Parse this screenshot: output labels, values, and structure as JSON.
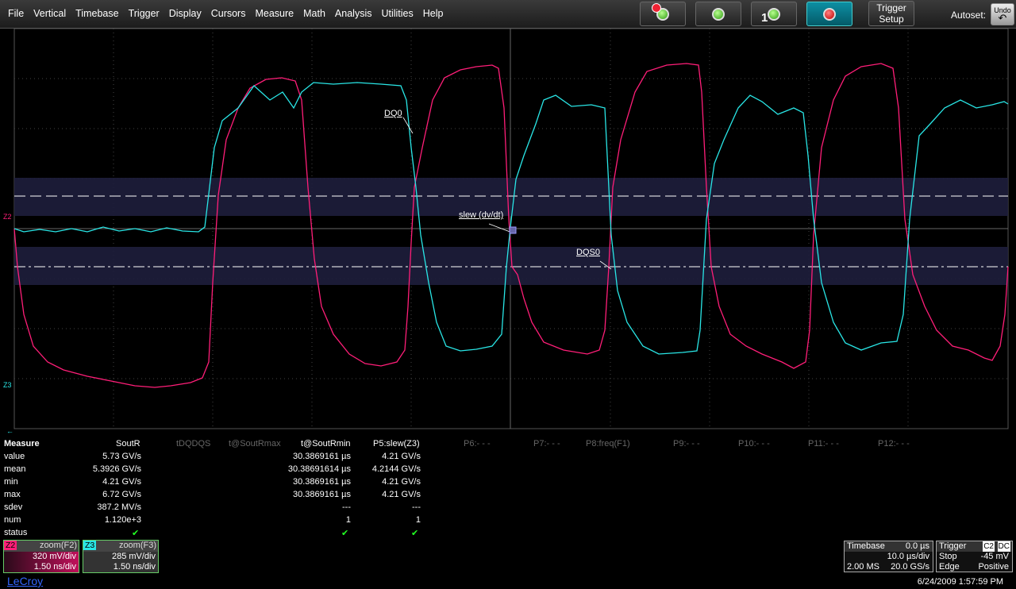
{
  "menu": [
    "File",
    "Vertical",
    "Timebase",
    "Trigger",
    "Display",
    "Cursors",
    "Measure",
    "Math",
    "Analysis",
    "Utilities",
    "Help"
  ],
  "toolbar": {
    "channel_number": "1",
    "trigger_setup_line1": "Trigger",
    "trigger_setup_line2": "Setup",
    "autoset": "Autoset:",
    "undo": "Undo"
  },
  "waveform": {
    "annotation_dq0": "DQ0",
    "annotation_slew": "slew (dv/dt)",
    "annotation_dqs0": "DQS0",
    "marker_z2": "Z2",
    "marker_z3": "Z3"
  },
  "measure": {
    "header": [
      "Measure",
      "SoutR",
      "tDQDQS",
      "t@SoutRmax",
      "t@SoutRmin",
      "P5:slew(Z3)",
      "P6:- - -",
      "P7:- - -",
      "P8:freq(F1)",
      "P9:- - -",
      "P10:- - -",
      "P11:- - -",
      "P12:- - -"
    ],
    "rows": [
      {
        "label": "value",
        "soutr": "5.73 GV/s",
        "tsoutrmin": "30.3869161 µs",
        "p5": "4.21 GV/s"
      },
      {
        "label": "mean",
        "soutr": "5.3926 GV/s",
        "tsoutrmin": "30.38691614 µs",
        "p5": "4.2144 GV/s"
      },
      {
        "label": "min",
        "soutr": "4.21 GV/s",
        "tsoutrmin": "30.3869161 µs",
        "p5": "4.21 GV/s"
      },
      {
        "label": "max",
        "soutr": "6.72 GV/s",
        "tsoutrmin": "30.3869161 µs",
        "p5": "4.21 GV/s"
      },
      {
        "label": "sdev",
        "soutr": "387.2 MV/s",
        "tsoutrmin": "---",
        "p5": "---"
      },
      {
        "label": "num",
        "soutr": "1.120e+3",
        "tsoutrmin": "1",
        "p5": "1"
      },
      {
        "label": "status",
        "soutr": "✔",
        "tsoutrmin": "✔",
        "p5": "✔"
      }
    ]
  },
  "traces": {
    "z2": {
      "tag": "Z2",
      "source": "zoom(F2)",
      "vdiv": "320 mV/div",
      "tdiv": "1.50 ns/div",
      "color": "#ff1e78"
    },
    "z3": {
      "tag": "Z3",
      "source": "zoom(F3)",
      "vdiv": "285 mV/div",
      "tdiv": "1.50 ns/div",
      "color": "#29e6e6"
    }
  },
  "timebase": {
    "label": "Timebase",
    "delay": "0.0 µs",
    "tdiv": "10.0 µs/div",
    "samples": "2.00 MS",
    "rate": "20.0 GS/s"
  },
  "trigger": {
    "label": "Trigger",
    "channel": "C2",
    "coupling": "DC",
    "mode": "Stop",
    "level": "-45 mV",
    "type": "Edge",
    "slope": "Positive"
  },
  "brand": "LeCroy",
  "datetime": "6/24/2009 1:57:59 PM"
}
